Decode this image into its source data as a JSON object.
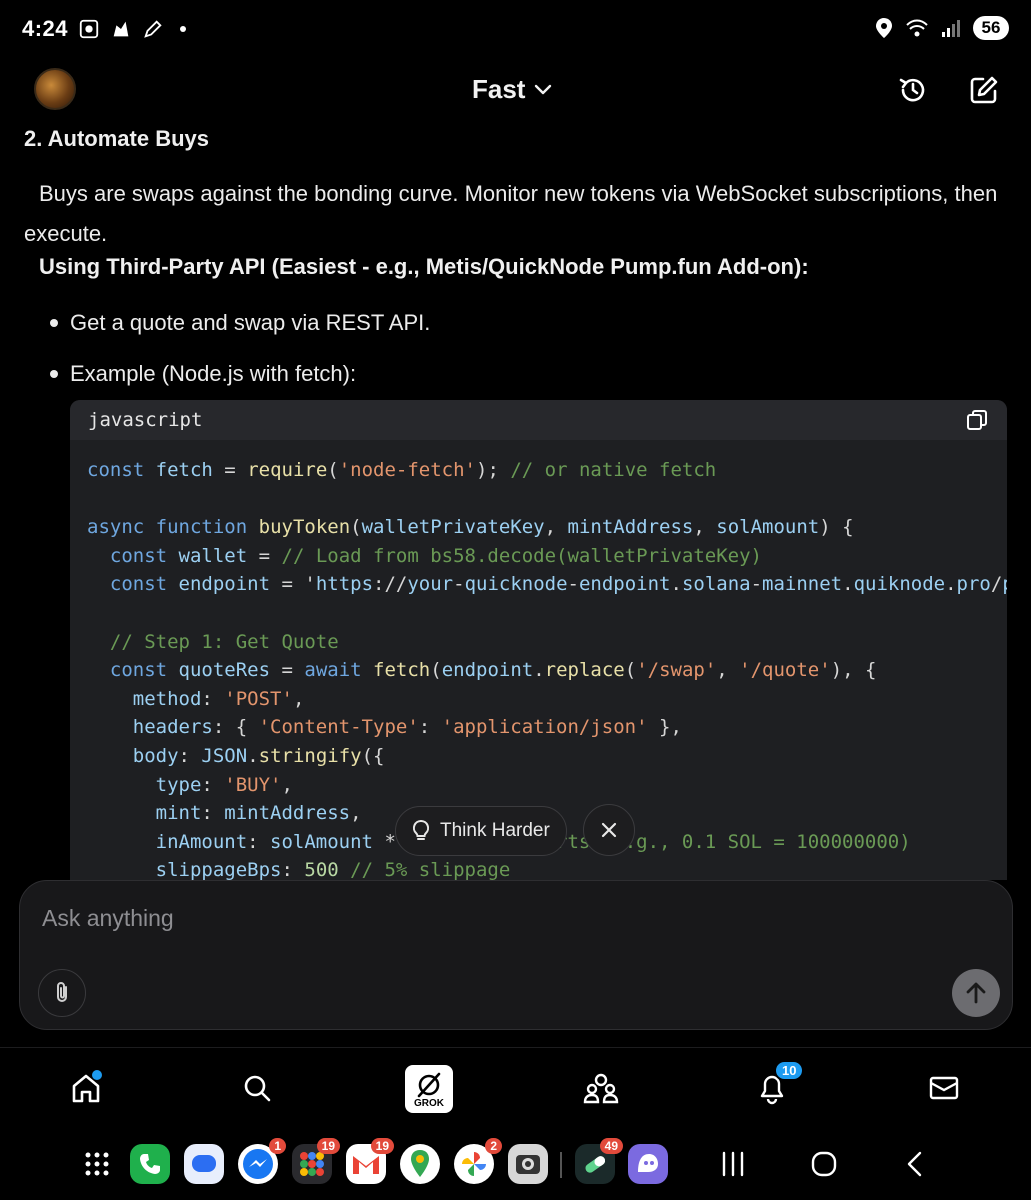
{
  "status_bar": {
    "time": "4:24",
    "battery": "56"
  },
  "header": {
    "mode_label": "Fast"
  },
  "content": {
    "heading": "2. Automate Buys",
    "paragraph": "Buys are swaps against the bonding curve. Monitor new tokens via WebSocket subscriptions, then execute.",
    "subheading": "Using Third-Party API (Easiest - e.g., Metis/QuickNode Pump.fun Add-on):",
    "bullets": [
      "Get a quote and swap via REST API.",
      "Example (Node.js with fetch):"
    ]
  },
  "code_block": {
    "language": "javascript",
    "lines": [
      "const fetch = require('node-fetch'); // or native fetch",
      "",
      "async function buyToken(walletPrivateKey, mintAddress, solAmount) {",
      "  const wallet = // Load from bs58.decode(walletPrivateKey)",
      "  const endpoint = 'https://your-quicknode-endpoint.solana-mainnet.quiknode.pro/p",
      "",
      "  // Step 1: Get Quote",
      "  const quoteRes = await fetch(endpoint.replace('/swap', '/quote'), {",
      "    method: 'POST',",
      "    headers: { 'Content-Type': 'application/json' },",
      "    body: JSON.stringify({",
      "      type: 'BUY',",
      "      mint: mintAddress,",
      "      inAmount: solAmount * 1e9, // Lamports (e.g., 0.1 SOL = 100000000)",
      "      slippageBps: 500 // 5% slippage"
    ]
  },
  "think_harder": {
    "label": "Think Harder"
  },
  "composer": {
    "placeholder": "Ask anything"
  },
  "bottom_nav": {
    "grok_label": "GROK",
    "notifications_badge": "10"
  },
  "dock": {
    "badges": {
      "messenger": "1",
      "apps_folder": "19",
      "gmail": "19",
      "photos": "2",
      "pill_app": "49"
    }
  }
}
